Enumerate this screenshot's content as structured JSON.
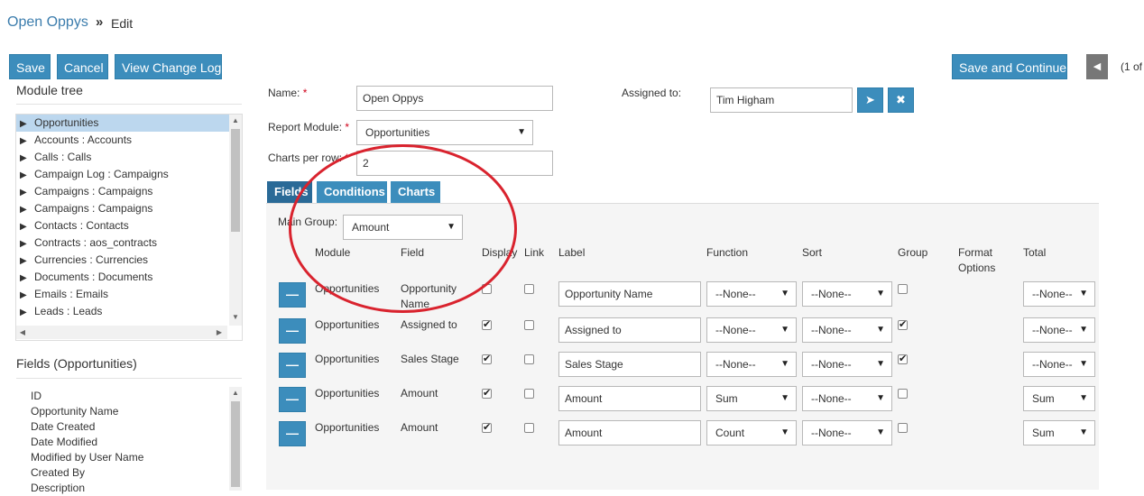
{
  "breadcrumb": {
    "link": "Open Oppys",
    "sep": "»",
    "current": "Edit"
  },
  "toolbar": {
    "save": "Save",
    "cancel": "Cancel",
    "change_log": "View Change Log",
    "save_continue": "Save and Continue",
    "prev_icon": "chevron-left-icon",
    "pager": "(1 of"
  },
  "module_tree": {
    "title": "Module tree",
    "items": [
      "Opportunities",
      "Accounts : Accounts",
      "Calls : Calls",
      "Campaign Log : Campaigns",
      "Campaigns : Campaigns",
      "Campaigns : Campaigns",
      "Contacts : Contacts",
      "Contracts : aos_contracts",
      "Currencies : Currencies",
      "Documents : Documents",
      "Emails : Emails",
      "Leads : Leads"
    ]
  },
  "fields_panel": {
    "title": "Fields (Opportunities)",
    "items": [
      "ID",
      "Opportunity Name",
      "Date Created",
      "Date Modified",
      "Modified by User Name",
      "Created By",
      "Description"
    ]
  },
  "form": {
    "name_label": "Name:",
    "req": "*",
    "name_value": "Open Oppys",
    "assigned_label": "Assigned to:",
    "assigned_value": "Tim Higham",
    "module_label": "Report Module:",
    "module_value": "Opportunities",
    "charts_label": "Charts per row:",
    "charts_value": "2"
  },
  "tabs": [
    "Fields",
    "Conditions",
    "Charts"
  ],
  "main_group": {
    "label": "Main Group:",
    "value": "Amount"
  },
  "columns": {
    "module": "Module",
    "field": "Field",
    "display": "Display",
    "link": "Link",
    "label": "Label",
    "function": "Function",
    "sort": "Sort",
    "group": "Group",
    "format": "Format Options",
    "total": "Total"
  },
  "rows": [
    {
      "module": "Opportunities",
      "field": "Opportunity Name",
      "display": false,
      "link": false,
      "label": "Opportunity Name",
      "function": "--None--",
      "sort": "--None--",
      "group": false,
      "total": "--None--"
    },
    {
      "module": "Opportunities",
      "field": "Assigned to",
      "display": true,
      "link": false,
      "label": "Assigned to",
      "function": "--None--",
      "sort": "--None--",
      "group": true,
      "total": "--None--"
    },
    {
      "module": "Opportunities",
      "field": "Sales Stage",
      "display": true,
      "link": false,
      "label": "Sales Stage",
      "function": "--None--",
      "sort": "--None--",
      "group": true,
      "total": "--None--"
    },
    {
      "module": "Opportunities",
      "field": "Amount",
      "display": true,
      "link": false,
      "label": "Amount",
      "function": "Sum",
      "sort": "--None--",
      "group": false,
      "total": "Sum"
    },
    {
      "module": "Opportunities",
      "field": "Amount",
      "display": true,
      "link": false,
      "label": "Amount",
      "function": "Count",
      "sort": "--None--",
      "group": false,
      "total": "Sum"
    }
  ],
  "annotation": {
    "color": "#d9232e"
  }
}
